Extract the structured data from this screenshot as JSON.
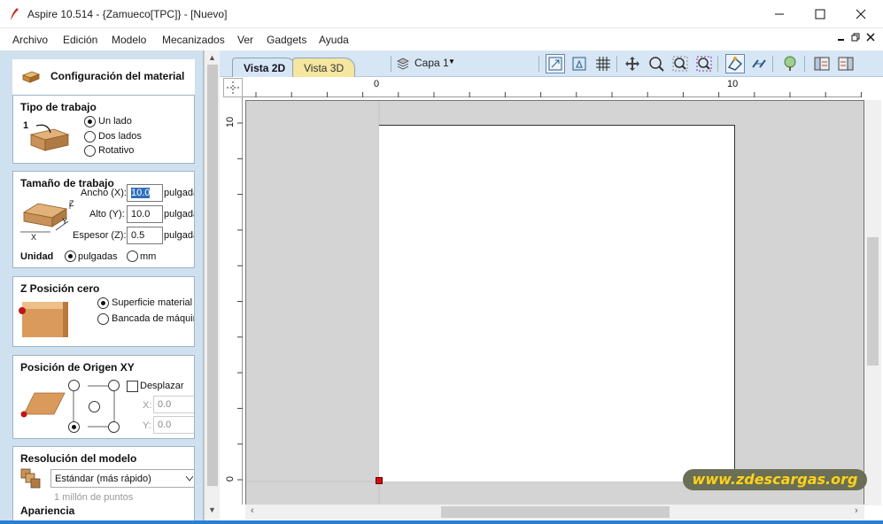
{
  "window": {
    "title": "Aspire 10.514 - {Zamueco[TPC]} - [Nuevo]"
  },
  "menu": [
    "Archivo",
    "Edición",
    "Modelo",
    "Mecanizados",
    "Ver",
    "Gadgets",
    "Ayuda"
  ],
  "panel": {
    "title": "Configuración del material",
    "job_type": {
      "header": "Tipo de trabajo",
      "step": "1",
      "options": [
        "Un lado",
        "Dos lados",
        "Rotativo"
      ],
      "selected": "Un lado"
    },
    "job_size": {
      "header": "Tamaño de trabajo",
      "width_label": "Ancho (X):",
      "width_value": "10.0",
      "height_label": "Alto (Y):",
      "height_value": "10.0",
      "thickness_label": "Espesor (Z):",
      "thickness_value": "0.5",
      "unit_text": "pulgadas",
      "axis_z": "Z",
      "axis_y": "Y",
      "axis_x": "X",
      "units_label": "Unidad",
      "unit_options": [
        "pulgadas",
        "mm"
      ],
      "unit_selected": "pulgadas"
    },
    "z_zero": {
      "header": "Z Posición cero",
      "options": [
        "Superficie material",
        "Bancada de máquina"
      ],
      "selected": "Superficie material"
    },
    "xy_origin": {
      "header": "Posición de Origen XY",
      "offset_label": "Desplazar",
      "x_label": "X:",
      "x_value": "0.0",
      "y_label": "Y:",
      "y_value": "0.0"
    },
    "resolution": {
      "header": "Resolución del modelo",
      "selected": "Estándar (más rápido)",
      "note": "1 millón de puntos"
    },
    "appearance": {
      "header": "Apariencia"
    }
  },
  "toolbar": {
    "tab_2d": "Vista 2D",
    "tab_3d": "Vista 3D",
    "layer": "Capa 1"
  },
  "rulers": {
    "top_labels": [
      "0",
      "10"
    ],
    "left_labels": [
      "10",
      "0"
    ]
  },
  "watermark": "www.zdescargas.org"
}
